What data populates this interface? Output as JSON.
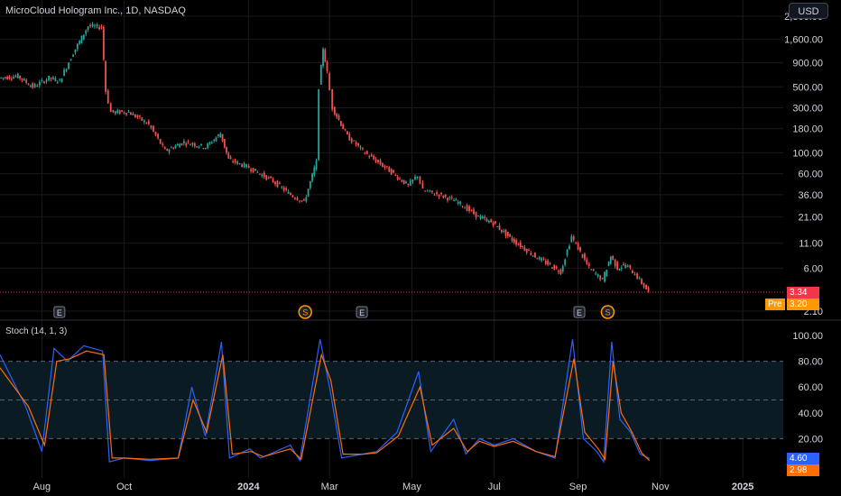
{
  "header": {
    "title": "MicroCloud Hologram Inc., 1D, NASDAQ",
    "currency": "USD"
  },
  "colors": {
    "background": "#000000",
    "up": "#26a69a",
    "down": "#ef5350",
    "grid": "#1a1a1a",
    "axis_text": "#d1d4dc",
    "stoch_k": "#2962ff",
    "stoch_d": "#ff6d00",
    "band_fill": "#0b1b24",
    "band_line": "#5d606b",
    "last_price": "#f23645",
    "pre_market": "#ff9800"
  },
  "price_pane": {
    "y_ticks": [
      "2,800.00",
      "1,600.00",
      "900.00",
      "500.00",
      "300.00",
      "180.00",
      "100.00",
      "60.00",
      "36.00",
      "21.00",
      "11.00",
      "6.00",
      "2.10"
    ],
    "last_price_label": "3.34",
    "pre_label": "Pre",
    "pre_price_label": "3.20",
    "events": [
      {
        "type": "earnings",
        "label": "E",
        "date": "2023-08-14"
      },
      {
        "type": "split",
        "label": "S",
        "date": "2024-02-12"
      },
      {
        "type": "earnings",
        "label": "E",
        "date": "2024-03-25"
      },
      {
        "type": "earnings",
        "label": "E",
        "date": "2024-09-02"
      },
      {
        "type": "split",
        "label": "S",
        "date": "2024-09-23"
      }
    ]
  },
  "stoch_pane": {
    "label": "Stoch (14, 1, 3)",
    "y_ticks": [
      "100.00",
      "80.00",
      "60.00",
      "40.00",
      "20.00"
    ],
    "k_label": "4.60",
    "d_label": "2.98"
  },
  "x_ticks": [
    "Aug",
    "Oct",
    "2024",
    "Mar",
    "May",
    "Jul",
    "Sep",
    "Nov",
    "2025"
  ],
  "chart_data": [
    {
      "type": "line",
      "title": "MicroCloud Hologram Inc., 1D, NASDAQ",
      "y_scale": "log",
      "ylim": [
        2.1,
        2800
      ],
      "series": [
        {
          "points": [
            [
              "2023-07-01",
              620
            ],
            [
              "2023-07-15",
              650
            ],
            [
              "2023-07-26",
              500
            ],
            [
              "2023-08-07",
              620
            ],
            [
              "2023-08-15",
              580
            ],
            [
              "2023-08-25",
              1150
            ],
            [
              "2023-09-05",
              2200
            ],
            [
              "2023-09-15",
              2150
            ],
            [
              "2023-09-18",
              450
            ],
            [
              "2023-09-22",
              270
            ],
            [
              "2023-10-05",
              270
            ],
            [
              "2023-10-20",
              200
            ],
            [
              "2023-11-01",
              105
            ],
            [
              "2023-11-15",
              130
            ],
            [
              "2023-12-01",
              115
            ],
            [
              "2023-12-12",
              160
            ],
            [
              "2023-12-18",
              85
            ],
            [
              "2024-01-02",
              70
            ],
            [
              "2024-01-20",
              50
            ],
            [
              "2024-02-02",
              36
            ],
            [
              "2024-02-12",
              30
            ],
            [
              "2024-02-21",
              80
            ],
            [
              "2024-02-23",
              500
            ],
            [
              "2024-02-26",
              1300
            ],
            [
              "2024-02-29",
              700
            ],
            [
              "2024-03-04",
              300
            ],
            [
              "2024-03-15",
              150
            ],
            [
              "2024-03-28",
              100
            ],
            [
              "2024-04-15",
              65
            ],
            [
              "2024-04-29",
              45
            ],
            [
              "2024-05-06",
              58
            ],
            [
              "2024-05-10",
              40
            ],
            [
              "2024-05-22",
              36
            ],
            [
              "2024-06-05",
              30
            ],
            [
              "2024-06-20",
              21
            ],
            [
              "2024-07-01",
              18
            ],
            [
              "2024-07-15",
              12
            ],
            [
              "2024-08-01",
              8
            ],
            [
              "2024-08-20",
              5.5
            ],
            [
              "2024-08-28",
              13
            ],
            [
              "2024-09-10",
              6
            ],
            [
              "2024-09-20",
              4.5
            ],
            [
              "2024-09-26",
              8
            ],
            [
              "2024-10-01",
              6
            ],
            [
              "2024-10-07",
              6.5
            ],
            [
              "2024-10-14",
              5.2
            ],
            [
              "2024-10-24",
              3.34
            ]
          ]
        }
      ]
    },
    {
      "type": "line",
      "title": "Stoch (14, 1, 3)",
      "ylim": [
        0,
        100
      ],
      "series": [
        {
          "name": "%K",
          "points": [
            [
              "2023-07-01",
              85
            ],
            [
              "2023-07-20",
              45
            ],
            [
              "2023-08-01",
              10
            ],
            [
              "2023-08-10",
              90
            ],
            [
              "2023-08-20",
              80
            ],
            [
              "2023-09-01",
              92
            ],
            [
              "2023-09-15",
              88
            ],
            [
              "2023-09-20",
              2
            ],
            [
              "2023-10-01",
              5
            ],
            [
              "2023-10-20",
              3
            ],
            [
              "2023-11-10",
              5
            ],
            [
              "2023-11-20",
              60
            ],
            [
              "2023-11-30",
              22
            ],
            [
              "2023-12-08",
              70
            ],
            [
              "2023-12-12",
              95
            ],
            [
              "2023-12-18",
              5
            ],
            [
              "2024-01-02",
              12
            ],
            [
              "2024-01-10",
              5
            ],
            [
              "2024-02-01",
              15
            ],
            [
              "2024-02-08",
              3
            ],
            [
              "2024-02-23",
              97
            ],
            [
              "2024-03-01",
              60
            ],
            [
              "2024-03-10",
              5
            ],
            [
              "2024-03-25",
              8
            ],
            [
              "2024-04-05",
              10
            ],
            [
              "2024-04-20",
              25
            ],
            [
              "2024-05-06",
              72
            ],
            [
              "2024-05-15",
              10
            ],
            [
              "2024-06-01",
              35
            ],
            [
              "2024-06-10",
              8
            ],
            [
              "2024-06-20",
              20
            ],
            [
              "2024-07-01",
              15
            ],
            [
              "2024-07-15",
              20
            ],
            [
              "2024-08-01",
              10
            ],
            [
              "2024-08-15",
              5
            ],
            [
              "2024-08-28",
              97
            ],
            [
              "2024-09-05",
              20
            ],
            [
              "2024-09-15",
              10
            ],
            [
              "2024-09-20",
              2
            ],
            [
              "2024-09-26",
              95
            ],
            [
              "2024-10-02",
              35
            ],
            [
              "2024-10-10",
              25
            ],
            [
              "2024-10-17",
              8
            ],
            [
              "2024-10-24",
              4.6
            ]
          ]
        },
        {
          "name": "%D",
          "points": [
            [
              "2023-07-01",
              75
            ],
            [
              "2023-07-22",
              45
            ],
            [
              "2023-08-03",
              15
            ],
            [
              "2023-08-12",
              80
            ],
            [
              "2023-08-22",
              82
            ],
            [
              "2023-09-03",
              88
            ],
            [
              "2023-09-16",
              85
            ],
            [
              "2023-09-22",
              5
            ],
            [
              "2023-10-01",
              5
            ],
            [
              "2023-10-20",
              4
            ],
            [
              "2023-11-10",
              5
            ],
            [
              "2023-11-21",
              50
            ],
            [
              "2023-12-01",
              25
            ],
            [
              "2023-12-09",
              65
            ],
            [
              "2023-12-13",
              85
            ],
            [
              "2023-12-20",
              8
            ],
            [
              "2024-01-03",
              10
            ],
            [
              "2024-01-12",
              6
            ],
            [
              "2024-02-01",
              12
            ],
            [
              "2024-02-09",
              4
            ],
            [
              "2024-02-24",
              85
            ],
            [
              "2024-03-02",
              65
            ],
            [
              "2024-03-11",
              8
            ],
            [
              "2024-03-26",
              8
            ],
            [
              "2024-04-05",
              9
            ],
            [
              "2024-04-21",
              22
            ],
            [
              "2024-05-07",
              60
            ],
            [
              "2024-05-16",
              15
            ],
            [
              "2024-06-01",
              28
            ],
            [
              "2024-06-11",
              10
            ],
            [
              "2024-06-20",
              18
            ],
            [
              "2024-07-01",
              14
            ],
            [
              "2024-07-15",
              18
            ],
            [
              "2024-08-01",
              10
            ],
            [
              "2024-08-15",
              6
            ],
            [
              "2024-08-29",
              82
            ],
            [
              "2024-09-06",
              25
            ],
            [
              "2024-09-16",
              12
            ],
            [
              "2024-09-21",
              4
            ],
            [
              "2024-09-27",
              80
            ],
            [
              "2024-10-03",
              40
            ],
            [
              "2024-10-11",
              25
            ],
            [
              "2024-10-18",
              9
            ],
            [
              "2024-10-24",
              2.98
            ]
          ]
        }
      ]
    }
  ]
}
